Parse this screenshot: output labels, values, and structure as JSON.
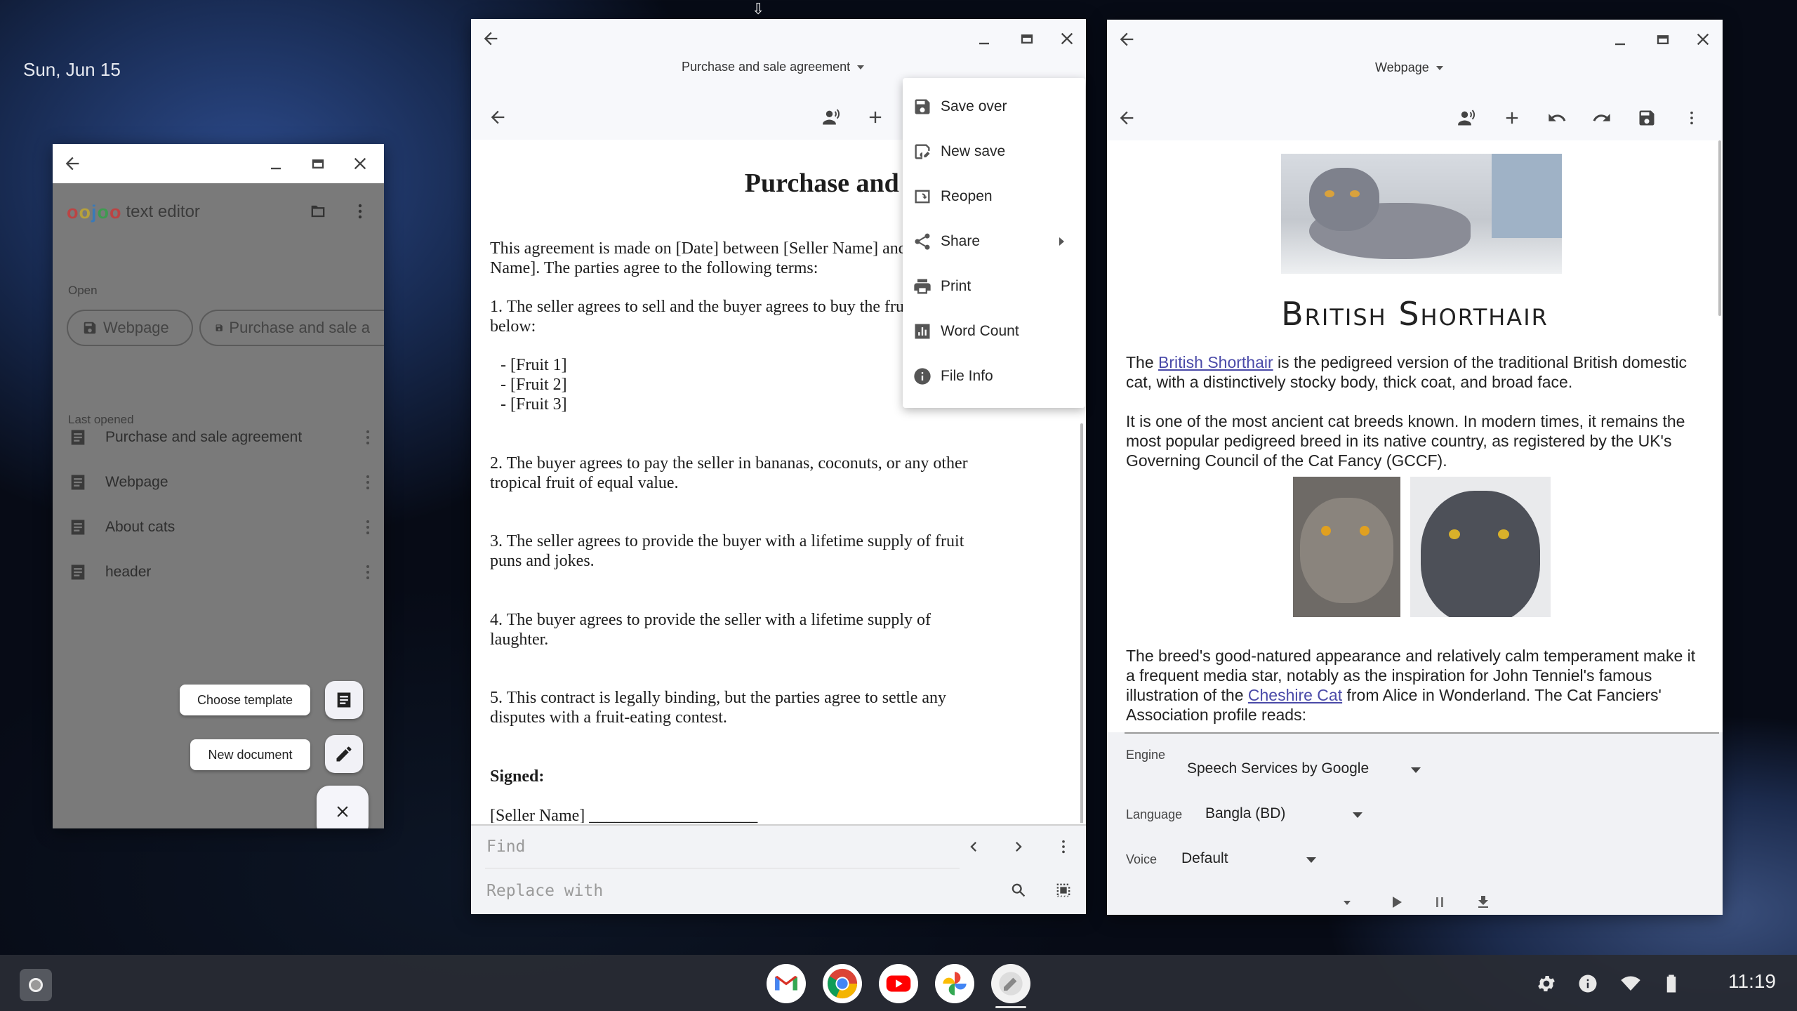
{
  "desktop": {
    "date": "Sun, Jun 15"
  },
  "launcher": {
    "app_name": "text editor",
    "logo_letters": [
      "o",
      "o",
      "j",
      "o",
      "o"
    ],
    "open_label": "Open",
    "open_chips": [
      "Webpage",
      "Purchase and sale a"
    ],
    "last_opened_label": "Last opened",
    "recent_files": [
      "Purchase and sale agreement",
      "Webpage",
      "About cats",
      "header"
    ],
    "choose_template": "Choose template",
    "new_document": "New document"
  },
  "editor": {
    "title": "Purchase and sale agreement",
    "heading": "Purchase and sale agreement",
    "paragraphs": [
      "This agreement is made on [Date] between [Seller Name] and [Buyer",
      "Name]. The parties agree to the following terms:",
      "1. The seller agrees to sell and the buyer agrees to buy the fruit listed",
      "below:",
      "- [Fruit 1]",
      "- [Fruit 2]",
      "- [Fruit 3]",
      "2. The buyer agrees to pay the seller in bananas, coconuts, or any other",
      "tropical fruit of equal value.",
      "3. The seller agrees to provide the buyer with a lifetime supply of fruit",
      "puns and jokes.",
      "4. The buyer agrees to provide the seller with a lifetime supply of",
      "laughter.",
      "5. This contract is legally binding, but the parties agree to settle any",
      "disputes with a fruit-eating contest.",
      "Signed:",
      "[Seller Name] ____________________"
    ],
    "find_placeholder": "Find",
    "replace_placeholder": "Replace with"
  },
  "menu": {
    "items": [
      "Save over",
      "New save",
      "Reopen",
      "Share",
      "Print",
      "Word Count",
      "File Info"
    ]
  },
  "webview": {
    "title": "Webpage",
    "heading": "British Shorthair",
    "p1_before": "The ",
    "p1_link": "British Shorthair",
    "p1_after_1": " is the pedigreed version of the traditional British domestic",
    "p1_after_2": "cat, with a distinctively stocky body, thick coat, and broad face.",
    "p2_1": "It is one of the most ancient cat breeds known. In modern times, it remains the",
    "p2_2": "most popular pedigreed breed in its native country, as registered by the UK's",
    "p2_3": "Governing Council of the Cat Fancy (GCCF).",
    "p3_1": "The breed's good-natured appearance and relatively calm temperament make it",
    "p3_2": "a frequent media star, notably as the inspiration for John Tenniel's famous",
    "p3_3a": "illustration of the ",
    "p3_link": "Cheshire Cat",
    "p3_3b": " from Alice in Wonderland. The Cat Fanciers'",
    "p3_4": "Association profile reads:",
    "tts": {
      "engine_label": "Engine",
      "engine_value": "Speech Services by Google",
      "language_label": "Language",
      "language_value": "Bangla (BD)",
      "voice_label": "Voice",
      "voice_value": "Default"
    }
  },
  "shelf": {
    "apps": [
      "gmail-icon",
      "chrome-icon",
      "youtube-icon",
      "photos-icon",
      "text-editor-icon"
    ],
    "time": "11:19"
  },
  "colors": {
    "shelf": "#282b34",
    "launcher_bg": "#7a7a7a",
    "link": "#4a4aa8"
  }
}
